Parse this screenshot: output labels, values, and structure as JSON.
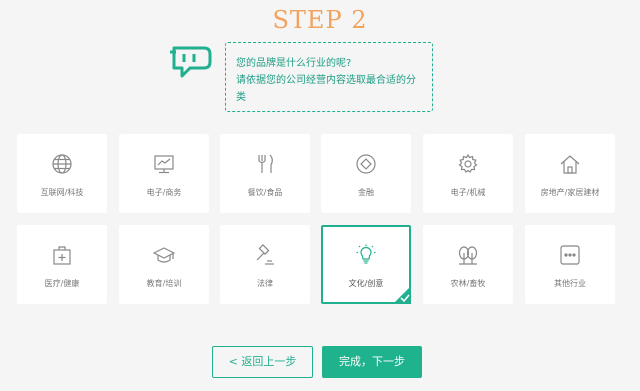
{
  "step_title": "STEP 2",
  "bubble": {
    "line1": "您的品牌是什么行业的呢?",
    "line2": "请依据您的公司经营内容选取最合适的分",
    "line3": "类"
  },
  "categories": [
    {
      "label": "互联网/科技",
      "icon": "globe-icon"
    },
    {
      "label": "电子/商务",
      "icon": "monitor-chart-icon"
    },
    {
      "label": "餐饮/食品",
      "icon": "fork-knife-icon"
    },
    {
      "label": "金融",
      "icon": "coin-icon"
    },
    {
      "label": "电子/机械",
      "icon": "gear-icon"
    },
    {
      "label": "房地产/家居建材",
      "icon": "house-icon"
    },
    {
      "label": "医疗/健康",
      "icon": "medical-kit-icon"
    },
    {
      "label": "教育/培训",
      "icon": "graduation-cap-icon"
    },
    {
      "label": "法律",
      "icon": "gavel-icon"
    },
    {
      "label": "文化/创意",
      "icon": "lightbulb-icon",
      "selected": true
    },
    {
      "label": "农林/畜牧",
      "icon": "trees-icon"
    },
    {
      "label": "其他行业",
      "icon": "more-dots-icon"
    }
  ],
  "buttons": {
    "prev": "< 返回上一步",
    "next": "完成，下一步"
  },
  "colors": {
    "accent": "#21b08f",
    "title": "#f2a35e",
    "background": "#f5f5f5"
  }
}
